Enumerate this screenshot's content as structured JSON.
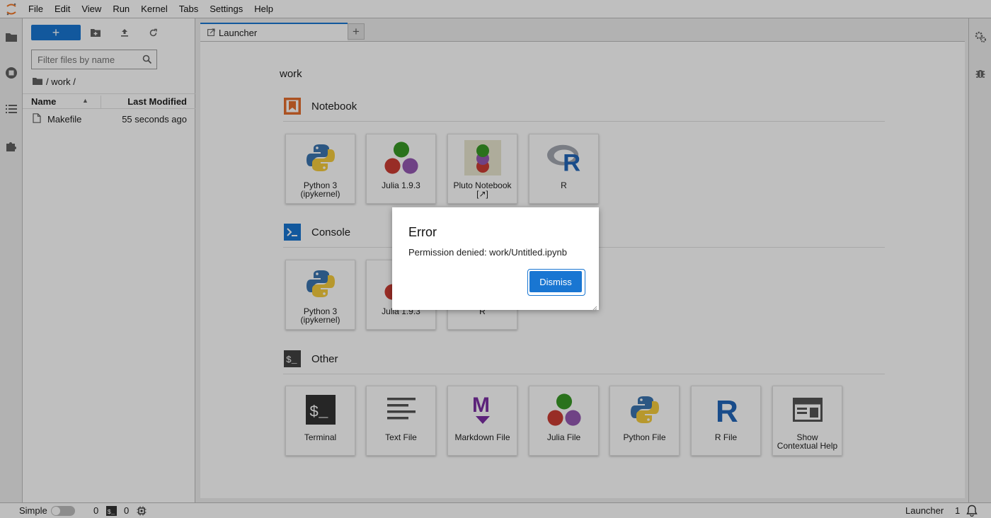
{
  "menu": [
    "File",
    "Edit",
    "View",
    "Run",
    "Kernel",
    "Tabs",
    "Settings",
    "Help"
  ],
  "file_browser": {
    "new_label": "+",
    "filter_placeholder": "Filter files by name",
    "breadcrumb": "/ work /",
    "columns": {
      "name": "Name",
      "modified": "Last Modified"
    },
    "files": [
      {
        "name": "Makefile",
        "modified": "55 seconds ago"
      }
    ]
  },
  "tabs": [
    {
      "label": "Launcher"
    }
  ],
  "launcher": {
    "cwd": "work",
    "sections": {
      "notebook": "Notebook",
      "console": "Console",
      "other": "Other"
    },
    "notebook_cards": [
      "Python 3\n(ipykernel)",
      "Julia 1.9.3",
      "Pluto Notebook\n[↗]",
      "R"
    ],
    "console_cards": [
      "Python 3\n(ipykernel)",
      "Julia 1.9.3",
      "R"
    ],
    "other_cards": [
      "Terminal",
      "Text File",
      "Markdown File",
      "Julia File",
      "Python File",
      "R File",
      "Show\nContextual Help"
    ]
  },
  "dialog": {
    "title": "Error",
    "body": "Permission denied: work/Untitled.ipynb",
    "button": "Dismiss"
  },
  "statusbar": {
    "mode_label": "Simple",
    "terminals": "0",
    "kernels": "0",
    "active": "Launcher",
    "count": "1"
  },
  "colors": {
    "accent": "#1976d2",
    "orange": "#e46e2e",
    "console_blue": "#1976d2"
  }
}
